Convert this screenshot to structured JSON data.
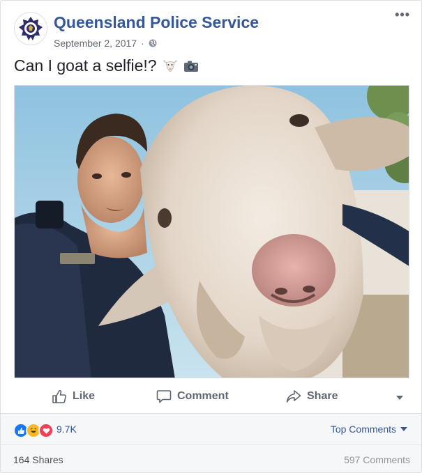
{
  "post": {
    "page_name": "Queensland Police Service",
    "date": "September 2, 2017",
    "privacy_icon": "globe-icon",
    "more_icon": "ellipsis-icon",
    "more_label": "•••",
    "caption": "Can I goat a selfie!?",
    "caption_emojis": [
      "goat-emoji",
      "camera-emoji"
    ],
    "photo_icon": "goat-selfie-photo"
  },
  "actions": {
    "like": "Like",
    "comment": "Comment",
    "share": "Share"
  },
  "reactions": {
    "icons": [
      "like-reaction-icon",
      "haha-reaction-icon",
      "love-reaction-icon"
    ],
    "count": "9.7K",
    "top_comments": "Top Comments"
  },
  "footer": {
    "shares": "164 Shares",
    "comments": "597 Comments"
  },
  "colors": {
    "link": "#365899",
    "text": "#1d2129",
    "muted": "#616770",
    "like_blue": "#1877f2",
    "haha_yellow": "#f7b928",
    "love_red": "#f33e58"
  }
}
